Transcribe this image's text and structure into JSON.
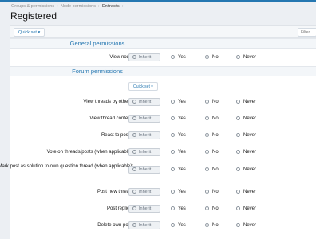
{
  "breadcrumb": [
    "Groups & permissions",
    "Node permissions",
    "Entracts"
  ],
  "page_title": "Registered",
  "quick_set_label": "Quick set ▾",
  "filter_placeholder": "Filter...",
  "sections": [
    {
      "title": "General permissions"
    },
    {
      "title": "Forum permissions"
    }
  ],
  "inner_quick_set_label": "Quick set ▾",
  "inherit_label": "Inherit",
  "options": {
    "yes": "Yes",
    "no": "No",
    "never": "Never"
  },
  "general_rows": [
    {
      "label": "View node:"
    }
  ],
  "forum_rows": [
    {
      "label": "View threads by others:"
    },
    {
      "label": "View thread content:"
    },
    {
      "label": "React to posts:"
    },
    {
      "label": "Vote on threads/posts (when applicable):"
    },
    {
      "label": "Mark post as solution to own question thread (when applicable):"
    },
    {
      "label": "Post new thread:"
    },
    {
      "label": "Post replies:"
    },
    {
      "label": "Delete own post:"
    }
  ]
}
